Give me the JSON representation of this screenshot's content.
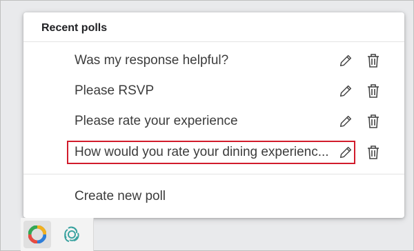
{
  "menu": {
    "header": "Recent polls",
    "polls": [
      {
        "label": "Was my response helpful?"
      },
      {
        "label": "Please RSVP"
      },
      {
        "label": "Please rate your experience"
      },
      {
        "label": "How would you rate your dining experienc..."
      }
    ],
    "create_label": "Create new poll"
  },
  "colors": {
    "highlight": "#d11b2b",
    "icon": "#444444"
  },
  "icons": {
    "edit": "pencil-icon",
    "delete": "trash-icon"
  }
}
